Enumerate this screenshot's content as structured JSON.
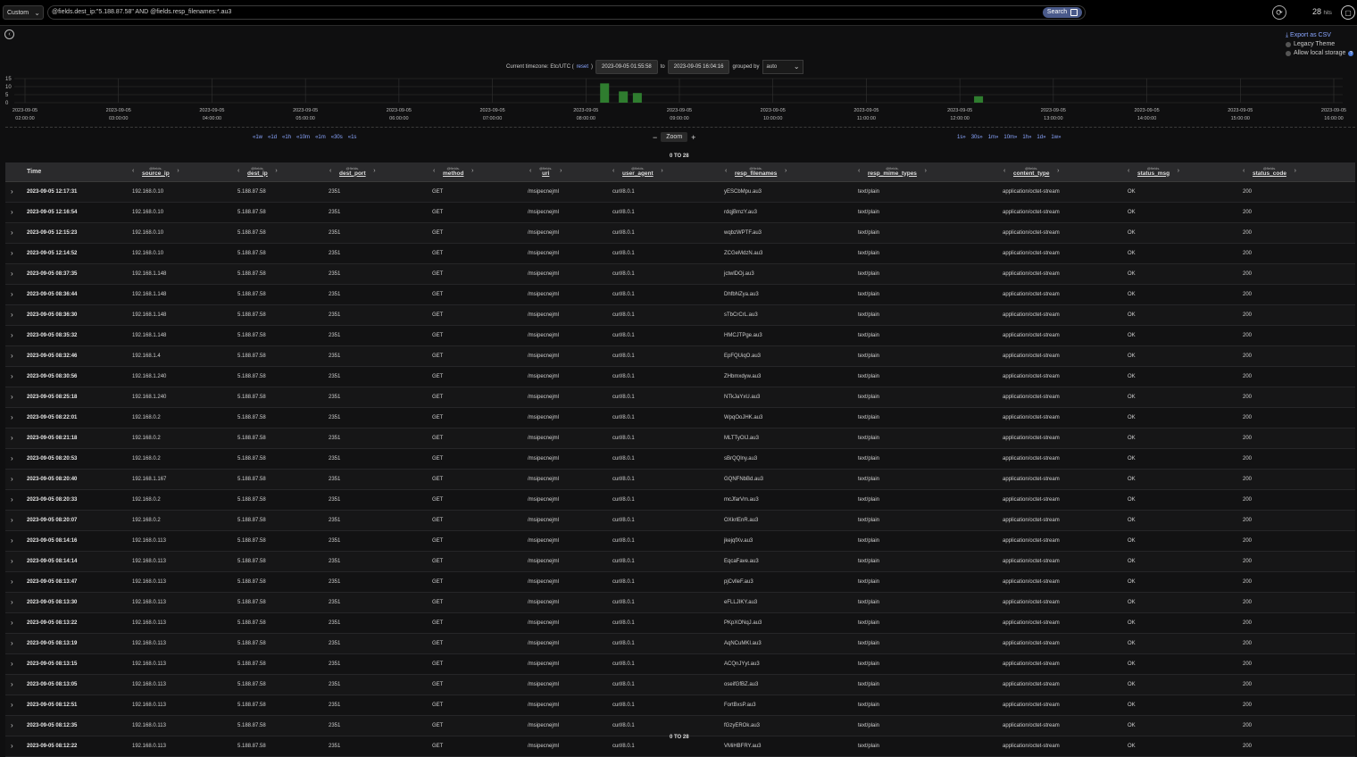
{
  "topbar": {
    "range_select": "Custom",
    "query": "@fields.dest_ip:\"5.188.87.58\" AND @fields.resp_filenames:*.au3",
    "search_label": "Search",
    "hits_count": "28",
    "hits_unit": "hits"
  },
  "side": {
    "export_csv": "Export as CSV",
    "legacy_theme": "Legacy Theme",
    "allow_storage": "Allow local storage"
  },
  "timezone": {
    "label": "Current timezone: Etc/UTC (",
    "reset": "reset",
    "close": ")",
    "from": "2023-09-05 01:55:58",
    "to_label": "to",
    "to": "2023-09-05 16:04:16",
    "grouped_label": "grouped by",
    "grouped_value": "auto"
  },
  "histogram": {
    "y_ticks": [
      "15",
      "10",
      "5",
      "0"
    ],
    "x_ticks": [
      [
        "2023-09-05",
        "02:00:00"
      ],
      [
        "2023-09-05",
        "03:00:00"
      ],
      [
        "2023-09-05",
        "04:00:00"
      ],
      [
        "2023-09-05",
        "05:00:00"
      ],
      [
        "2023-09-05",
        "06:00:00"
      ],
      [
        "2023-09-05",
        "07:00:00"
      ],
      [
        "2023-09-05",
        "08:00:00"
      ],
      [
        "2023-09-05",
        "09:00:00"
      ],
      [
        "2023-09-05",
        "10:00:00"
      ],
      [
        "2023-09-05",
        "11:00:00"
      ],
      [
        "2023-09-05",
        "12:00:00"
      ],
      [
        "2023-09-05",
        "13:00:00"
      ],
      [
        "2023-09-05",
        "14:00:00"
      ],
      [
        "2023-09-05",
        "15:00:00"
      ],
      [
        "2023-09-05",
        "16:00:00"
      ]
    ],
    "bars": [
      {
        "hour": 8.2,
        "value": 12
      },
      {
        "hour": 8.4,
        "value": 7
      },
      {
        "hour": 8.55,
        "value": 6
      },
      {
        "hour": 12.2,
        "value": 4
      }
    ],
    "bar_color": "#2f7d2f"
  },
  "nav": {
    "back": [
      "«1w",
      "«1d",
      "«1h",
      "«10m",
      "«1m",
      "«30s",
      "«1s"
    ],
    "forward": [
      "1s»",
      "30s»",
      "1m»",
      "10m»",
      "1h»",
      "1d»",
      "1w»"
    ],
    "zoom_label": "Zoom",
    "zoom_minus": "−",
    "zoom_plus": "+"
  },
  "range_text": "0 TO 28",
  "columns": [
    {
      "pre": "",
      "name": "Time"
    },
    {
      "pre": "@fields.",
      "name": "source_ip"
    },
    {
      "pre": "@fields.",
      "name": "dest_ip"
    },
    {
      "pre": "@fields.",
      "name": "dest_port"
    },
    {
      "pre": "@fields.",
      "name": "method"
    },
    {
      "pre": "@fields.",
      "name": "uri"
    },
    {
      "pre": "@fields.",
      "name": "user_agent"
    },
    {
      "pre": "@fields.",
      "name": "resp_filenames"
    },
    {
      "pre": "@fields.",
      "name": "resp_mime_types"
    },
    {
      "pre": "@fields.",
      "name": "content_type"
    },
    {
      "pre": "@fields.",
      "name": "status_msg"
    },
    {
      "pre": "@fields.",
      "name": "status_code"
    }
  ],
  "rows": [
    [
      "2023-09-05 12:17:31",
      "192.168.0.10",
      "5.188.87.58",
      "2351",
      "GET",
      "/msipecnejml",
      "curl/8.0.1",
      "yESCbMpu.au3",
      "text/plain",
      "application/octet-stream",
      "OK",
      "200"
    ],
    [
      "2023-09-05 12:16:54",
      "192.168.0.10",
      "5.188.87.58",
      "2351",
      "GET",
      "/msipecnejml",
      "curl/8.0.1",
      "rdqjBmzY.au3",
      "text/plain",
      "application/octet-stream",
      "OK",
      "200"
    ],
    [
      "2023-09-05 12:15:23",
      "192.168.0.10",
      "5.188.87.58",
      "2351",
      "GET",
      "/msipecnejml",
      "curl/8.0.1",
      "wqbzWPTF.au3",
      "text/plain",
      "application/octet-stream",
      "OK",
      "200"
    ],
    [
      "2023-09-05 12:14:52",
      "192.168.0.10",
      "5.188.87.58",
      "2351",
      "GET",
      "/msipecnejml",
      "curl/8.0.1",
      "ZCGeMdzN.au3",
      "text/plain",
      "application/octet-stream",
      "OK",
      "200"
    ],
    [
      "2023-09-05 08:37:35",
      "192.168.1.148",
      "5.188.87.58",
      "2351",
      "GET",
      "/msipecnejml",
      "curl/8.0.1",
      "jctwlDOj.au3",
      "text/plain",
      "application/octet-stream",
      "OK",
      "200"
    ],
    [
      "2023-09-05 08:36:44",
      "192.168.1.148",
      "5.188.87.58",
      "2351",
      "GET",
      "/msipecnejml",
      "curl/8.0.1",
      "DhfbNZya.au3",
      "text/plain",
      "application/octet-stream",
      "OK",
      "200"
    ],
    [
      "2023-09-05 08:36:30",
      "192.168.1.148",
      "5.188.87.58",
      "2351",
      "GET",
      "/msipecnejml",
      "curl/8.0.1",
      "sTbCrCrL.au3",
      "text/plain",
      "application/octet-stream",
      "OK",
      "200"
    ],
    [
      "2023-09-05 08:35:32",
      "192.168.1.148",
      "5.188.87.58",
      "2351",
      "GET",
      "/msipecnejml",
      "curl/8.0.1",
      "HMCJTPge.au3",
      "text/plain",
      "application/octet-stream",
      "OK",
      "200"
    ],
    [
      "2023-09-05 08:32:46",
      "192.168.1.4",
      "5.188.87.58",
      "2351",
      "GET",
      "/msipecnejml",
      "curl/8.0.1",
      "EpFQUiqO.au3",
      "text/plain",
      "application/octet-stream",
      "OK",
      "200"
    ],
    [
      "2023-09-05 08:30:56",
      "192.168.1.240",
      "5.188.87.58",
      "2351",
      "GET",
      "/msipecnejml",
      "curl/8.0.1",
      "ZHbmxdyw.au3",
      "text/plain",
      "application/octet-stream",
      "OK",
      "200"
    ],
    [
      "2023-09-05 08:25:18",
      "192.168.1.240",
      "5.188.87.58",
      "2351",
      "GET",
      "/msipecnejml",
      "curl/8.0.1",
      "NTkJaYxU.au3",
      "text/plain",
      "application/octet-stream",
      "OK",
      "200"
    ],
    [
      "2023-09-05 08:22:01",
      "192.168.0.2",
      "5.188.87.58",
      "2351",
      "GET",
      "/msipecnejml",
      "curl/8.0.1",
      "WpqOoJHK.au3",
      "text/plain",
      "application/octet-stream",
      "OK",
      "200"
    ],
    [
      "2023-09-05 08:21:18",
      "192.168.0.2",
      "5.188.87.58",
      "2351",
      "GET",
      "/msipecnejml",
      "curl/8.0.1",
      "MLTTyOIJ.au3",
      "text/plain",
      "application/octet-stream",
      "OK",
      "200"
    ],
    [
      "2023-09-05 08:20:53",
      "192.168.0.2",
      "5.188.87.58",
      "2351",
      "GET",
      "/msipecnejml",
      "curl/8.0.1",
      "sBrQQlny.au3",
      "text/plain",
      "application/octet-stream",
      "OK",
      "200"
    ],
    [
      "2023-09-05 08:20:40",
      "192.168.1.167",
      "5.188.87.58",
      "2351",
      "GET",
      "/msipecnejml",
      "curl/8.0.1",
      "GQNFNbBd.au3",
      "text/plain",
      "application/octet-stream",
      "OK",
      "200"
    ],
    [
      "2023-09-05 08:20:33",
      "192.168.0.2",
      "5.188.87.58",
      "2351",
      "GET",
      "/msipecnejml",
      "curl/8.0.1",
      "mcJfarVm.au3",
      "text/plain",
      "application/octet-stream",
      "OK",
      "200"
    ],
    [
      "2023-09-05 08:20:07",
      "192.168.0.2",
      "5.188.87.58",
      "2351",
      "GET",
      "/msipecnejml",
      "curl/8.0.1",
      "OXkrlEnR.au3",
      "text/plain",
      "application/octet-stream",
      "OK",
      "200"
    ],
    [
      "2023-09-05 08:14:16",
      "192.168.0.113",
      "5.188.87.58",
      "2351",
      "GET",
      "/msipecnejml",
      "curl/8.0.1",
      "jkejqfXv.au3",
      "text/plain",
      "application/octet-stream",
      "OK",
      "200"
    ],
    [
      "2023-09-05 08:14:14",
      "192.168.0.113",
      "5.188.87.58",
      "2351",
      "GET",
      "/msipecnejml",
      "curl/8.0.1",
      "EqcaFave.au3",
      "text/plain",
      "application/octet-stream",
      "OK",
      "200"
    ],
    [
      "2023-09-05 08:13:47",
      "192.168.0.113",
      "5.188.87.58",
      "2351",
      "GET",
      "/msipecnejml",
      "curl/8.0.1",
      "pjCvlleF.au3",
      "text/plain",
      "application/octet-stream",
      "OK",
      "200"
    ],
    [
      "2023-09-05 08:13:30",
      "192.168.0.113",
      "5.188.87.58",
      "2351",
      "GET",
      "/msipecnejml",
      "curl/8.0.1",
      "eFLLJIKY.au3",
      "text/plain",
      "application/octet-stream",
      "OK",
      "200"
    ],
    [
      "2023-09-05 08:13:22",
      "192.168.0.113",
      "5.188.87.58",
      "2351",
      "GET",
      "/msipecnejml",
      "curl/8.0.1",
      "PKpXONqJ.au3",
      "text/plain",
      "application/octet-stream",
      "OK",
      "200"
    ],
    [
      "2023-09-05 08:13:19",
      "192.168.0.113",
      "5.188.87.58",
      "2351",
      "GET",
      "/msipecnejml",
      "curl/8.0.1",
      "AqNCuMKI.au3",
      "text/plain",
      "application/octet-stream",
      "OK",
      "200"
    ],
    [
      "2023-09-05 08:13:15",
      "192.168.0.113",
      "5.188.87.58",
      "2351",
      "GET",
      "/msipecnejml",
      "curl/8.0.1",
      "ACQnJYyt.au3",
      "text/plain",
      "application/octet-stream",
      "OK",
      "200"
    ],
    [
      "2023-09-05 08:13:05",
      "192.168.0.113",
      "5.188.87.58",
      "2351",
      "GET",
      "/msipecnejml",
      "curl/8.0.1",
      "oseifGfBZ.au3",
      "text/plain",
      "application/octet-stream",
      "OK",
      "200"
    ],
    [
      "2023-09-05 08:12:51",
      "192.168.0.113",
      "5.188.87.58",
      "2351",
      "GET",
      "/msipecnejml",
      "curl/8.0.1",
      "FortBxsP.au3",
      "text/plain",
      "application/octet-stream",
      "OK",
      "200"
    ],
    [
      "2023-09-05 08:12:35",
      "192.168.0.113",
      "5.188.87.58",
      "2351",
      "GET",
      "/msipecnejml",
      "curl/8.0.1",
      "fGzyEROk.au3",
      "text/plain",
      "application/octet-stream",
      "OK",
      "200"
    ],
    [
      "2023-09-05 08:12:22",
      "192.168.0.113",
      "5.188.87.58",
      "2351",
      "GET",
      "/msipecnejml",
      "curl/8.0.1",
      "VMiHBFRY.au3",
      "text/plain",
      "application/octet-stream",
      "OK",
      "200"
    ]
  ]
}
